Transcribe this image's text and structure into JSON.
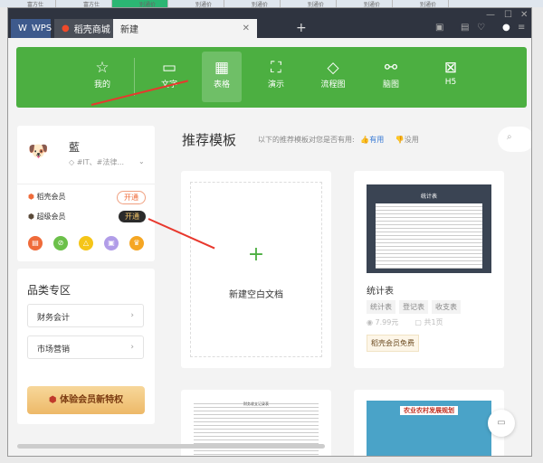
{
  "background_tabs": [
    "富方仕",
    "富方仕",
    "别通价",
    "别通价",
    "别通价",
    "别通价",
    "别通价",
    "别通价"
  ],
  "tabs": [
    {
      "label": "WPS"
    },
    {
      "label": "稻壳商城"
    },
    {
      "label": "新建"
    }
  ],
  "banner": [
    {
      "label": "我的",
      "icon": "star-icon"
    },
    {
      "label": "文字",
      "icon": "document-icon"
    },
    {
      "label": "表格",
      "icon": "table-icon"
    },
    {
      "label": "演示",
      "icon": "presentation-icon"
    },
    {
      "label": "流程图",
      "icon": "flowchart-icon"
    },
    {
      "label": "脑图",
      "icon": "mindmap-icon"
    },
    {
      "label": "H5",
      "icon": "h5-icon"
    }
  ],
  "profile": {
    "name": "藍",
    "tags": "#IT、#法律..."
  },
  "membership": [
    {
      "label": "稻壳会员",
      "action": "开通"
    },
    {
      "label": "超级会员",
      "action": "开通"
    }
  ],
  "category": {
    "title": "品类专区",
    "items": [
      "财务会计",
      "市场营销"
    ]
  },
  "promo_button": "体验会员新特权",
  "main": {
    "title": "推荐模板",
    "feedback_prompt": "以下的推荐模板对您是否有用:",
    "useful": "有用",
    "useless": "没用"
  },
  "blank_doc": {
    "label": "新建空白文档"
  },
  "template": {
    "preview_title": "统计表",
    "name": "统计表",
    "tags": [
      "统计表",
      "登记表",
      "收支表"
    ],
    "price": "7.99元",
    "pages": "共1页",
    "badge": "稻壳会员免费"
  },
  "bottom_templates": [
    "财务收支记录表",
    "农业农村发展规划"
  ]
}
